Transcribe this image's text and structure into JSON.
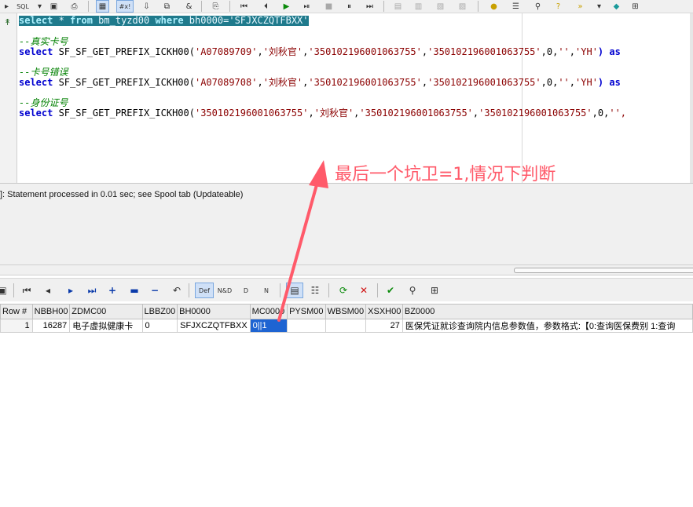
{
  "toolbar": {
    "sql_label": "SQL",
    "chars_label": "#x!"
  },
  "editor": {
    "line1": {
      "kw_select": "select",
      "star": " * ",
      "kw_from": "from",
      "table": " bm_tyzd00 ",
      "kw_where": "where",
      "cond": " bh0000=",
      "value": "'SFJXCZQTFBXX'"
    },
    "comment1": "--真实卡号",
    "query2": {
      "kw": "select",
      "fn": " SF_SF_GET_PREFIX_ICKH00(",
      "a1": "'A07089709'",
      "a2": "'刘秋官'",
      "a3": "'350102196001063755'",
      "a4": "'350102196001063755'",
      "a5": "0",
      "a6": "''",
      "a7": "'YH'",
      "tail": ") as"
    },
    "comment2": "--卡号错误",
    "query3": {
      "kw": "select",
      "fn": " SF_SF_GET_PREFIX_ICKH00(",
      "a1": "'A07089708'",
      "a2": "'刘秋官'",
      "a3": "'350102196001063755'",
      "a4": "'350102196001063755'",
      "a5": "0",
      "a6": "''",
      "a7": "'YH'",
      "tail": ") as"
    },
    "comment3": "--身份证号",
    "query4": {
      "kw": "select",
      "fn": " SF_SF_GET_PREFIX_ICKH00(",
      "a1": "'350102196001063755'",
      "a2": "'刘秋官'",
      "a3": "'350102196001063755'",
      "a4": "'350102196001063755'",
      "a5": "0",
      "tail": "'',"
    }
  },
  "annotation": {
    "text": "最后一个坑卫=1,情况下判断",
    "color": "#ff5a6a"
  },
  "status": {
    "message": "]: Statement processed in 0.01 sec; see Spool tab (Updateable)"
  },
  "grid_toolbar": {
    "def_label": "Def",
    "nd_label": "N&D",
    "d_label": "D",
    "n_label": "N"
  },
  "grid": {
    "columns": [
      "Row #",
      "NBBH00",
      "ZDMC00",
      "LBBZ00",
      "BH0000",
      "MC0000",
      "PYSM00",
      "WBSM00",
      "XSXH00",
      "BZ0000"
    ],
    "rows": [
      {
        "rownum": "1",
        "nbbh00": "16287",
        "zdmc00": "电子虚拟健康卡",
        "lbbz00": "0",
        "bh0000": "SFJXCZQTFBXX",
        "mc0000": "0||1",
        "pysm00": "",
        "wbsm00": "",
        "xsxh00": "27",
        "bz0000": "医保凭证就诊查询院内信息参数值，参数格式:【0:查询医保费别 1:查询"
      }
    ]
  },
  "colors": {
    "selected_cell": "#1e64d2",
    "highlight_line": "#1f7a8c",
    "keyword": "#0000d0",
    "comment": "#008000",
    "string": "#8b0000"
  }
}
